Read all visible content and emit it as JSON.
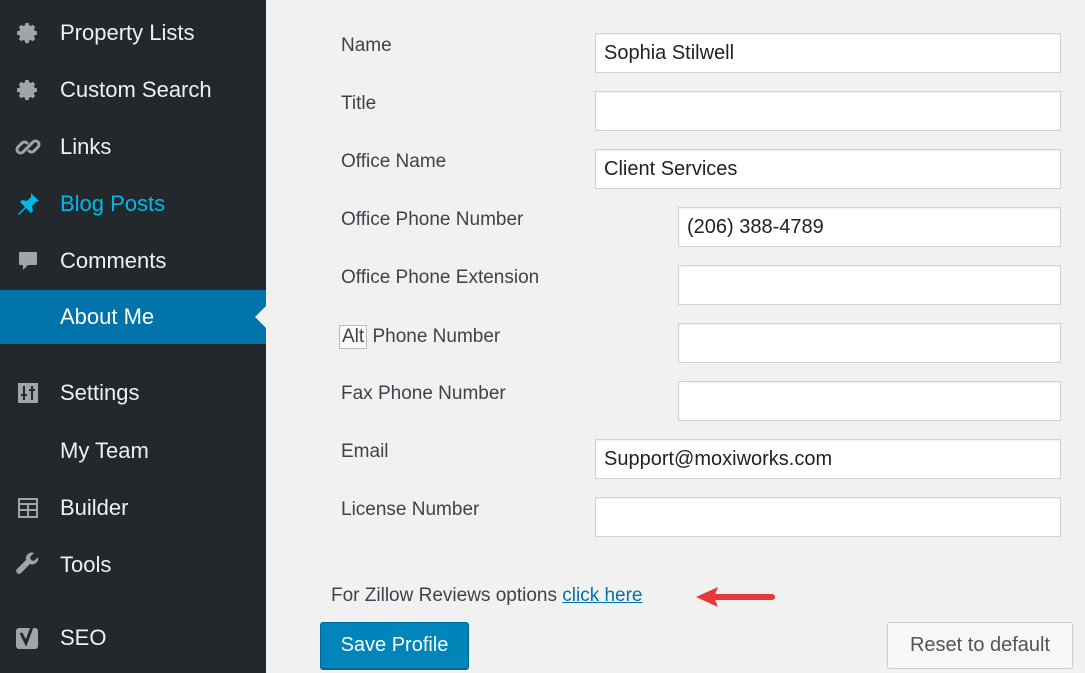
{
  "sidebar": {
    "items": [
      {
        "label": "Property Lists",
        "icon": "gear-icon"
      },
      {
        "label": "Custom Search",
        "icon": "gear-icon"
      },
      {
        "label": "Links",
        "icon": "link-icon"
      },
      {
        "label": "Blog Posts",
        "icon": "pushpin-icon"
      },
      {
        "label": "Comments",
        "icon": "comment-icon"
      },
      {
        "label": "About Me",
        "icon": ""
      },
      {
        "label": "Settings",
        "icon": "settings-icon"
      },
      {
        "label": "My Team",
        "icon": ""
      },
      {
        "label": "Builder",
        "icon": "builder-icon"
      },
      {
        "label": "Tools",
        "icon": "wrench-icon"
      },
      {
        "label": "SEO",
        "icon": "yoast-icon"
      }
    ],
    "active_color": "#0073aa",
    "highlight_color": "#00b9eb"
  },
  "form": {
    "fields": [
      {
        "label": "Name",
        "value": "Sophia Stilwell"
      },
      {
        "label": "Title",
        "value": ""
      },
      {
        "label": "Office Name",
        "value": "Client Services"
      },
      {
        "label": "Office Phone Number",
        "value": "(206) 388-4789"
      },
      {
        "label": "Office Phone Extension",
        "value": ""
      },
      {
        "label_prefix": "Alt",
        "label": " Phone Number",
        "value": ""
      },
      {
        "label": "Fax Phone Number",
        "value": ""
      },
      {
        "label": "Email",
        "value": "Support@moxiworks.com"
      },
      {
        "label": "License Number",
        "value": ""
      }
    ]
  },
  "zillow": {
    "text": "For Zillow Reviews options ",
    "link_text": "click here"
  },
  "buttons": {
    "save": "Save Profile",
    "reset": "Reset to default"
  },
  "annotation": {
    "arrow_color": "#e8393a"
  }
}
